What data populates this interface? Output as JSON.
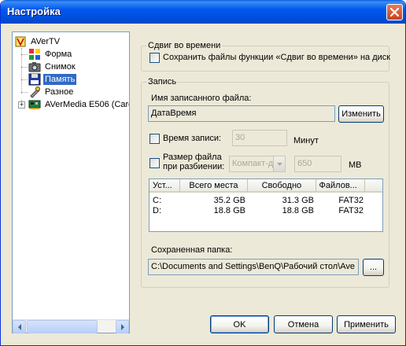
{
  "window": {
    "title": "Настройка"
  },
  "tree": {
    "root": "AVerTV",
    "items": [
      "Форма",
      "Снимок",
      "Память",
      "Разное"
    ],
    "device": "AVerMedia E506 (Card"
  },
  "timeshift": {
    "group_title": "Сдвиг во времени",
    "save_label": "Сохранить файлы функции «Сдвиг во времени» на диск"
  },
  "record": {
    "group_title": "Запись",
    "filename_label": "Имя записанного файла:",
    "filename_value": "ДатаВремя",
    "change_button": "Изменить",
    "time_label": "Время записи:",
    "time_value": "30",
    "time_unit": "Минут",
    "split_label_1": "Размер файла",
    "split_label_2": "при разбиении:",
    "split_select": "Компакт-д",
    "split_value": "650",
    "split_unit": "МВ",
    "columns": [
      "Уст...",
      "Всего места",
      "Свободно",
      "Файлов..."
    ],
    "drives": [
      {
        "drive": "C:",
        "total": "35.2 GB",
        "free": "31.3 GB",
        "fs": "FAT32"
      },
      {
        "drive": "D:",
        "total": "18.8 GB",
        "free": "18.8 GB",
        "fs": "FAT32"
      }
    ],
    "folder_label": "Сохраненная папка:",
    "folder_value": "C:\\Documents and Settings\\BenQ\\Рабочий стол\\Ave",
    "browse_button": "..."
  },
  "footer": {
    "ok": "OK",
    "cancel": "Отмена",
    "apply": "Применить"
  },
  "colors": {
    "title_bar": "#0058ee",
    "selection": "#316ac5",
    "dialog_bg": "#ece9d8"
  }
}
